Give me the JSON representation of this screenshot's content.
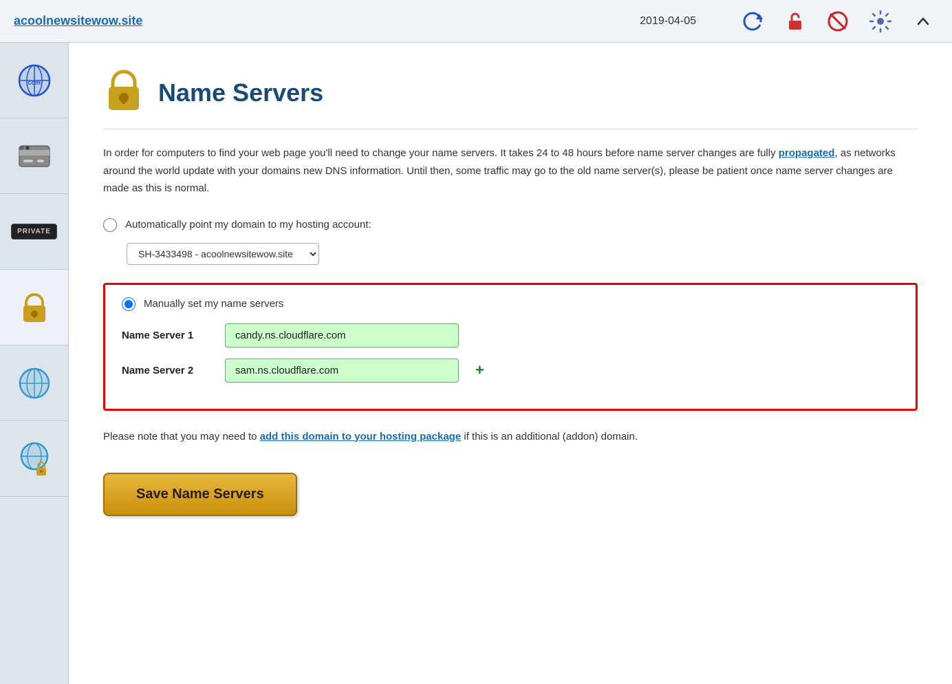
{
  "topbar": {
    "domain": "acoolnewsitewow.site",
    "date": "2019-04-05",
    "icons": {
      "refresh": "🔄",
      "lock_open": "🔓",
      "block": "🚫",
      "settings": "⚙"
    }
  },
  "sidebar": {
    "items": [
      {
        "name": "globe-com",
        "icon": "🌐",
        "label": "Globe COM"
      },
      {
        "name": "card",
        "icon": "🪪",
        "label": "Card"
      },
      {
        "name": "private",
        "icon": "PRIVATE",
        "label": "Private"
      },
      {
        "name": "lock",
        "icon": "🔒",
        "label": "Lock"
      },
      {
        "name": "globe-blue",
        "icon": "🌐",
        "label": "Globe Blue"
      },
      {
        "name": "globe-lock",
        "icon": "🌐",
        "label": "Globe Lock"
      }
    ]
  },
  "page": {
    "title": "Name Servers",
    "lock_icon": "🔒",
    "description_part1": "In order for computers to find your web page you'll need to change your name servers. It takes 24 to 48 hours before name server changes are fully ",
    "description_link": "propagated",
    "description_part2": ", as networks around the world update with your domains new DNS information. Until then, some traffic may go to the old name server(s), please be patient once name server changes are made as this is normal.",
    "option1_label": "Automatically point my domain to my hosting account:",
    "select_value": "SH-3433498 - acoolnewsitewow.site",
    "option2_label": "Manually set my name servers",
    "ns1_label": "Name Server 1",
    "ns1_value": "candy.ns.cloudflare.com",
    "ns2_label": "Name Server 2",
    "ns2_value": "sam.ns.cloudflare.com",
    "add_button": "+",
    "note_part1": "Please note that you may need to ",
    "note_link": "add this domain to your hosting package",
    "note_part2": " if this is an additional (addon) domain.",
    "save_button": "Save Name Servers"
  }
}
